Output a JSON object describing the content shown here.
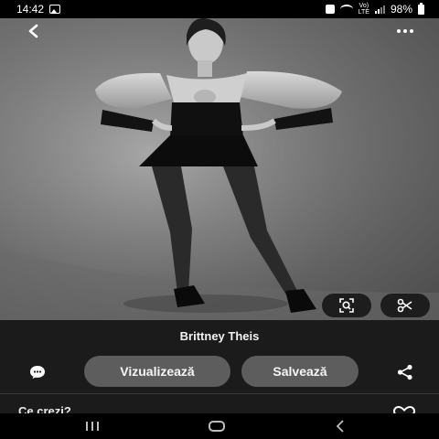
{
  "status_bar": {
    "time": "14:42",
    "battery": "98%",
    "icons": [
      "gallery-icon",
      "bag-icon",
      "wifi-icon",
      "volte-icon",
      "signal-icon",
      "battery-icon"
    ],
    "volte_top": "Vo)",
    "volte_bottom": "LTE"
  },
  "header": {
    "back_icon": "chevron-left-icon",
    "more_icon": "more-horizontal-icon"
  },
  "image_actions": {
    "lens_icon": "visual-search-icon",
    "cut_icon": "scissors-icon"
  },
  "pin": {
    "title": "Brittney Theis"
  },
  "actions": {
    "comment_icon": "comment-icon",
    "visit_label": "Vizualizează",
    "save_label": "Salvează",
    "share_icon": "share-icon"
  },
  "comments": {
    "prompt": "Ce crezi?",
    "react_icon": "heart-icon"
  },
  "nav_bar": {
    "recents_icon": "recents-icon",
    "home_icon": "home-icon",
    "back_icon": "back-icon"
  },
  "colors": {
    "panel": "#1b1b1b",
    "pill_button": "#5d5d5d",
    "icon_chip": "#1d1d1d"
  }
}
